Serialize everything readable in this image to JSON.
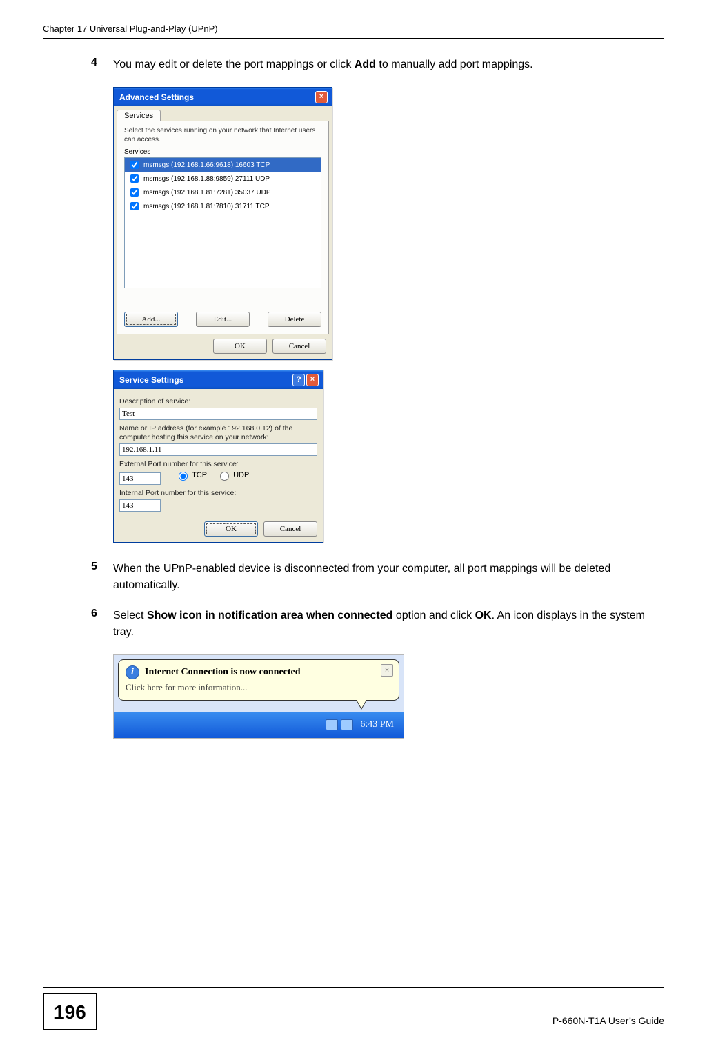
{
  "header": "Chapter 17 Universal Plug-and-Play (UPnP)",
  "steps": {
    "s4": {
      "num": "4",
      "pre": "You may edit or delete the port mappings or click ",
      "b": "Add",
      "post": " to manually add port mappings."
    },
    "s5": {
      "num": "5",
      "text": "When the UPnP-enabled device is disconnected from your computer, all port mappings will be deleted automatically."
    },
    "s6": {
      "num": "6",
      "pre": "Select ",
      "b1": "Show icon in notification area when connected",
      "mid": " option and click ",
      "b2": "OK",
      "post": ". An icon displays in the system tray."
    }
  },
  "dlg1": {
    "title": "Advanced Settings",
    "tab": "Services",
    "desc": "Select the services running on your network that Internet users can access.",
    "servicesLabel": "Services",
    "items": [
      {
        "label": "msmsgs (192.168.1.66:9618) 16603 TCP",
        "selected": true
      },
      {
        "label": "msmsgs (192.168.1.88:9859) 27111 UDP",
        "selected": false
      },
      {
        "label": "msmsgs (192.168.1.81:7281) 35037 UDP",
        "selected": false
      },
      {
        "label": "msmsgs (192.168.1.81:7810) 31711 TCP",
        "selected": false
      }
    ],
    "btnAdd": "Add...",
    "btnEdit": "Edit...",
    "btnDelete": "Delete",
    "btnOk": "OK",
    "btnCancel": "Cancel"
  },
  "dlg2": {
    "title": "Service Settings",
    "lblDesc": "Description of service:",
    "valDesc": "Test",
    "lblHost": "Name or IP address (for example 192.168.0.12) of the computer hosting this service on your network:",
    "valHost": "192.168.1.11",
    "lblExt": "External Port number for this service:",
    "valExt": "143",
    "lblInt": "Internal Port number for this service:",
    "valInt": "143",
    "protoTcp": "TCP",
    "protoUdp": "UDP",
    "btnOk": "OK",
    "btnCancel": "Cancel"
  },
  "balloon": {
    "title": "Internet Connection is now connected",
    "sub": "Click here for more information...",
    "clock": "6:43 PM"
  },
  "footer": {
    "pageNum": "196",
    "guide": "P-660N-T1A User’s Guide"
  }
}
